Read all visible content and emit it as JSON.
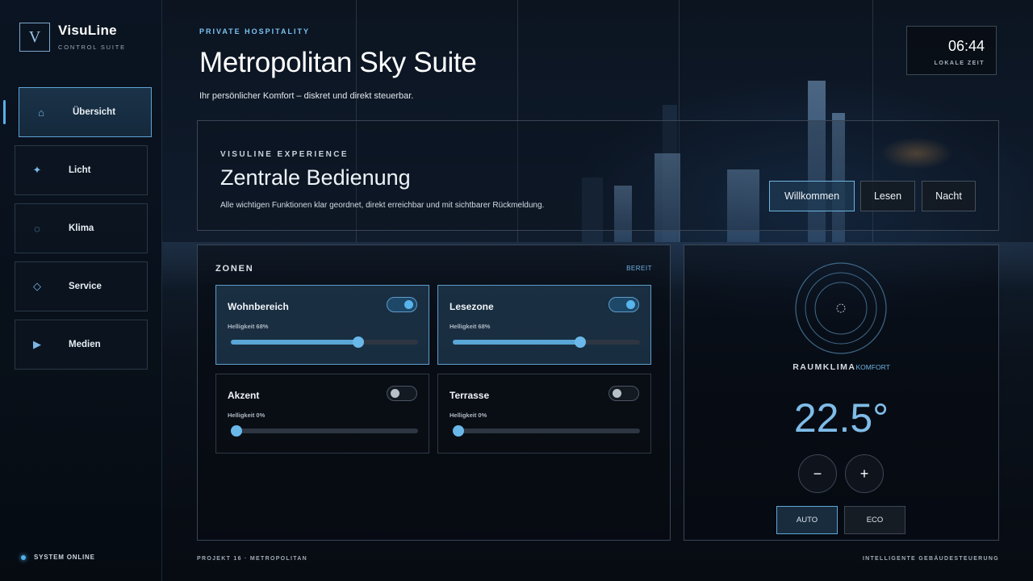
{
  "brand": {
    "logo_letter": "V",
    "name": "VisuLine",
    "subtitle": "CONTROL SUITE"
  },
  "sidebar": {
    "items": [
      {
        "label": "Übersicht",
        "icon": "home-icon",
        "active": true
      },
      {
        "label": "Licht",
        "icon": "sparkle-icon",
        "active": false
      },
      {
        "label": "Klima",
        "icon": "circle-icon",
        "active": false
      },
      {
        "label": "Service",
        "icon": "diamond-icon",
        "active": false
      },
      {
        "label": "Medien",
        "icon": "play-icon",
        "active": false
      }
    ],
    "status": "SYSTEM ONLINE"
  },
  "header": {
    "eyebrow": "PRIVATE HOSPITALITY",
    "title": "Metropolitan Sky Suite",
    "subtitle": "Ihr persönlicher Komfort – diskret und direkt steuerbar."
  },
  "clock": {
    "time": "06:44",
    "label": "LOKALE ZEIT"
  },
  "hero": {
    "eyebrow": "VISULINE EXPERIENCE",
    "title": "Zentrale Bedienung",
    "description": "Alle wichtigen Funktionen klar geordnet, direkt erreichbar und mit sichtbarer Rückmeldung.",
    "scenes": [
      {
        "label": "Willkommen",
        "active": true
      },
      {
        "label": "Lesen",
        "active": false
      },
      {
        "label": "Nacht",
        "active": false
      }
    ]
  },
  "zones": {
    "title": "ZONEN",
    "status": "BEREIT",
    "items": [
      {
        "name": "Wohnbereich",
        "on": true,
        "brightness_label": "Helligkeit 68%",
        "brightness": 68
      },
      {
        "name": "Lesezone",
        "on": true,
        "brightness_label": "Helligkeit 68%",
        "brightness": 68
      },
      {
        "name": "Akzent",
        "on": false,
        "brightness_label": "Helligkeit 0%",
        "brightness": 0
      },
      {
        "name": "Terrasse",
        "on": false,
        "brightness_label": "Helligkeit 0%",
        "brightness": 0
      }
    ]
  },
  "climate": {
    "label": "RAUMKLIMA",
    "mode_label": "KOMFORT",
    "temperature": "22.5°",
    "minus": "−",
    "plus": "+",
    "modes": [
      {
        "label": "AUTO",
        "active": true
      },
      {
        "label": "ECO",
        "active": false
      }
    ]
  },
  "footer": {
    "left": "PROJEKT 16 · METROPOLITAN",
    "right": "INTELLIGENTE GEBÄUDESTEUERUNG"
  },
  "colors": {
    "accent": "#5aa6d6",
    "accent_light": "#7fbce8",
    "background": "#070b12"
  }
}
